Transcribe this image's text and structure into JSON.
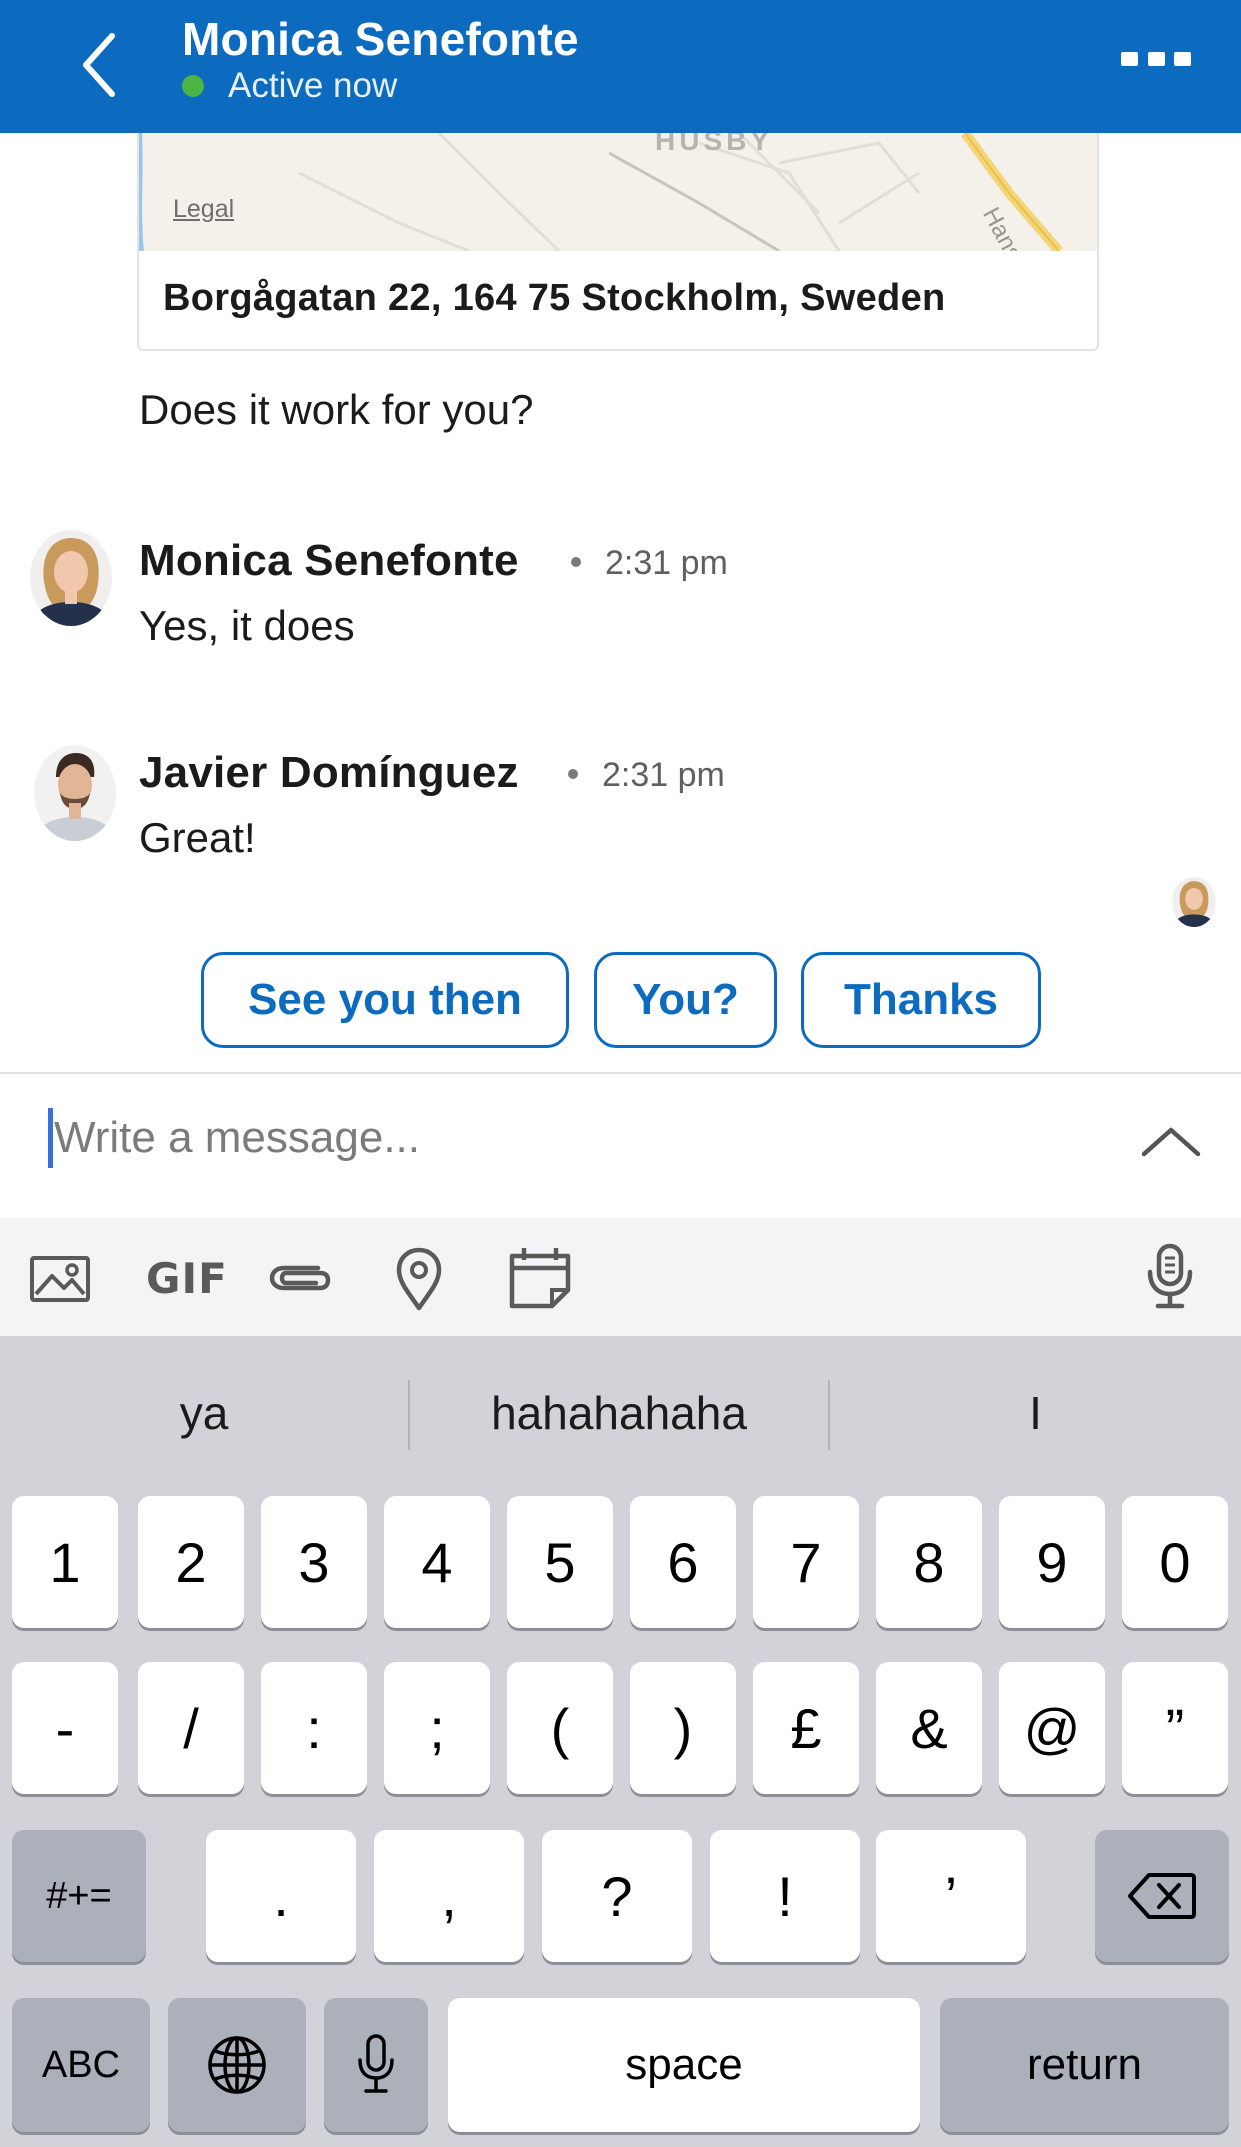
{
  "header": {
    "contact_name": "Monica Senefonte",
    "status": "Active now",
    "status_color": "#4bb543",
    "brand_color": "#0c6bbf"
  },
  "map_card": {
    "legal_label": "Legal",
    "area_label": "HUSBY",
    "road_label": "Hans",
    "address": "Borgågatan 22, 164 75 Stockholm, Sweden"
  },
  "messages": [
    {
      "sender": "",
      "time": "",
      "text": "Does it work for you?"
    },
    {
      "sender": "Monica Senefonte",
      "time": "2:31 pm",
      "text": "Yes, it does"
    },
    {
      "sender": "Javier Domínguez",
      "time": "2:31 pm",
      "text": "Great!"
    }
  ],
  "quick_replies": [
    "See you then",
    "You?",
    "Thanks"
  ],
  "compose": {
    "placeholder": "Write a message..."
  },
  "toolbar": {
    "gif_label": "GIF",
    "icons": [
      "image-icon",
      "gif-icon",
      "attachment-icon",
      "location-pin-icon",
      "calendar-icon",
      "microphone-icon"
    ]
  },
  "keyboard": {
    "suggestions": [
      "ya",
      "hahahahaha",
      "I"
    ],
    "row1": [
      "1",
      "2",
      "3",
      "4",
      "5",
      "6",
      "7",
      "8",
      "9",
      "0"
    ],
    "row2": [
      "-",
      "/",
      ":",
      ";",
      "(",
      ")",
      "£",
      "&",
      "@",
      "”"
    ],
    "row3_left": "#+=",
    "row3": [
      ".",
      ",",
      "?",
      "!",
      "’"
    ],
    "abc_label": "ABC",
    "space_label": "space",
    "return_label": "return"
  }
}
